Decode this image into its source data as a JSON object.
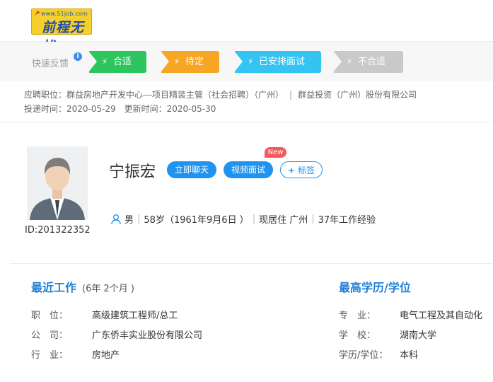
{
  "header": {
    "logo_url_text": "www.51job.com",
    "logo_name": "前程无忧"
  },
  "feedback": {
    "label": "快速反馈",
    "info_icon": "i",
    "buttons": [
      {
        "label": "合适",
        "color": "#2dc55e"
      },
      {
        "label": "待定",
        "color": "#f6a622"
      },
      {
        "label": "已安排面试",
        "color": "#34c4f2"
      },
      {
        "label": "不合适",
        "color": "#c9c9c9"
      }
    ]
  },
  "application": {
    "position_label": "应聘职位：",
    "position": "群益房地产开发中心---项目精装主管（社会招聘）（广州）",
    "separator": "|",
    "company": "群益投资（广州）股份有限公司",
    "delivered_label": "投递时间：",
    "delivered": "2020-05-29",
    "updated_label": "更新时间：",
    "updated": "2020-05-30"
  },
  "candidate": {
    "id_text": "ID:201322352",
    "name": "宁振宏",
    "chat_label": "立即聊天",
    "video_label": "视频面试",
    "new_badge": "New",
    "tag_label": "标签",
    "gender": "男",
    "age": "58岁（1961年9月6日 ）",
    "residence": "现居住 广州",
    "experience": "37年工作经验"
  },
  "recent_work": {
    "title": "最近工作",
    "duration": "(6年 2个月 )",
    "rows": [
      {
        "label": "职　位：",
        "value": "高级建筑工程师/总工"
      },
      {
        "label": "公　司：",
        "value": "广东侨丰实业股份有限公司"
      },
      {
        "label": "行　业：",
        "value": "房地产"
      }
    ]
  },
  "education": {
    "title": "最高学历/学位",
    "rows": [
      {
        "label": "专　业：",
        "value": "电气工程及其自动化"
      },
      {
        "label": "学　校：",
        "value": "湖南大学"
      },
      {
        "label": "学历/学位：",
        "value": "本科"
      }
    ]
  }
}
